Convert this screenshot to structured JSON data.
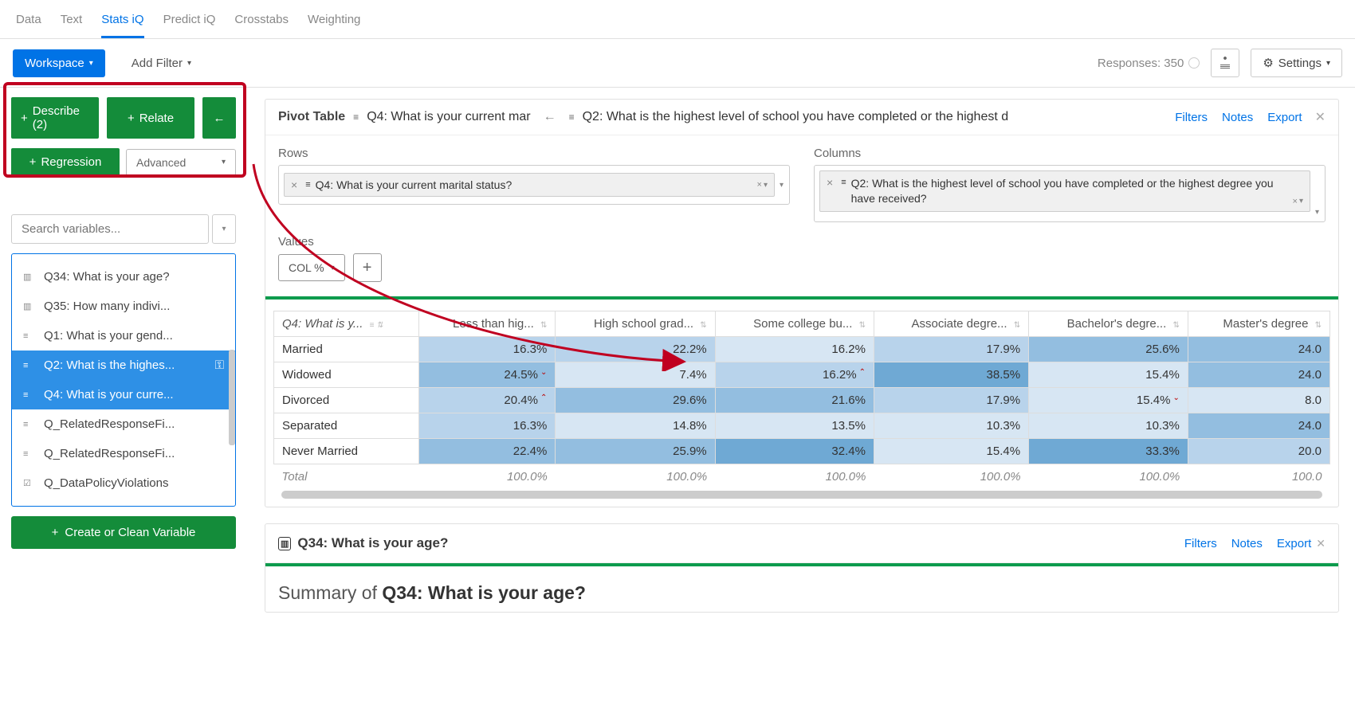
{
  "tabs": {
    "data": "Data",
    "text": "Text",
    "stats": "Stats iQ",
    "predict": "Predict iQ",
    "crosstabs": "Crosstabs",
    "weighting": "Weighting"
  },
  "subbar": {
    "workspace": "Workspace",
    "addfilter": "Add Filter",
    "responses": "Responses: 350",
    "settings": "Settings"
  },
  "actions": {
    "describe": "Describe (2)",
    "relate": "Relate",
    "regression": "Regression",
    "advanced": "Advanced"
  },
  "search": {
    "placeholder": "Search variables..."
  },
  "vars": {
    "q34": "Q34: What is your age?",
    "q35": "Q35: How many indivi...",
    "q1": "Q1: What is your gend...",
    "q2": "Q2: What is the highes...",
    "q4": "Q4: What is your curre...",
    "rrf1": "Q_RelatedResponseFi...",
    "rrf2": "Q_RelatedResponseFi...",
    "dpv": "Q_DataPolicyViolations"
  },
  "create": "Create or Clean Variable",
  "pivot": {
    "label": "Pivot Table",
    "q4_short": "Q4: What is your current mar",
    "q2_short": "Q2: What is the highest level of school you have completed or the highest d",
    "rows_label": "Rows",
    "cols_label": "Columns",
    "q4_full": "Q4: What is your current marital status?",
    "q2_full": "Q2: What is the highest level of school you have completed or the highest degree you have received?",
    "values_label": "Values",
    "colpct": "COL %",
    "links": {
      "filters": "Filters",
      "notes": "Notes",
      "export": "Export"
    }
  },
  "table": {
    "row_head": "Q4: What is y...",
    "cols": [
      "Less than hig...",
      "High school grad...",
      "Some college bu...",
      "Associate degre...",
      "Bachelor's degre...",
      "Master's degree"
    ],
    "rows": [
      {
        "label": "Married",
        "vals": [
          "16.3%",
          "22.2%",
          "16.2%",
          "17.9%",
          "25.6%",
          "24.0"
        ],
        "cls": [
          "c-l2",
          "c-l2",
          "c-l1",
          "c-l2",
          "c-l3",
          "c-l3"
        ]
      },
      {
        "label": "Widowed",
        "vals": [
          "24.5%",
          "7.4%",
          "16.2%",
          "38.5%",
          "15.4%",
          "24.0"
        ],
        "cls": [
          "c-l3",
          "c-l1",
          "c-l2",
          "c-l4",
          "c-l1",
          "c-l3"
        ],
        "ann": {
          "0": "v",
          "2": "^"
        }
      },
      {
        "label": "Divorced",
        "vals": [
          "20.4%",
          "29.6%",
          "21.6%",
          "17.9%",
          "15.4%",
          "8.0"
        ],
        "cls": [
          "c-l2",
          "c-l3",
          "c-l3",
          "c-l2",
          "c-l1",
          "c-l1"
        ],
        "ann": {
          "0": "^",
          "4": "v"
        }
      },
      {
        "label": "Separated",
        "vals": [
          "16.3%",
          "14.8%",
          "13.5%",
          "10.3%",
          "10.3%",
          "24.0"
        ],
        "cls": [
          "c-l2",
          "c-l1",
          "c-l1",
          "c-l1",
          "c-l1",
          "c-l3"
        ]
      },
      {
        "label": "Never Married",
        "vals": [
          "22.4%",
          "25.9%",
          "32.4%",
          "15.4%",
          "33.3%",
          "20.0"
        ],
        "cls": [
          "c-l3",
          "c-l3",
          "c-l4",
          "c-l1",
          "c-l4",
          "c-l2"
        ]
      }
    ],
    "total_label": "Total",
    "totals": [
      "100.0%",
      "100.0%",
      "100.0%",
      "100.0%",
      "100.0%",
      "100.0"
    ]
  },
  "card2": {
    "title": "Q34: What is your age?",
    "summary_pre": "Summary of ",
    "summary_bold": "Q34: What is your age?"
  }
}
